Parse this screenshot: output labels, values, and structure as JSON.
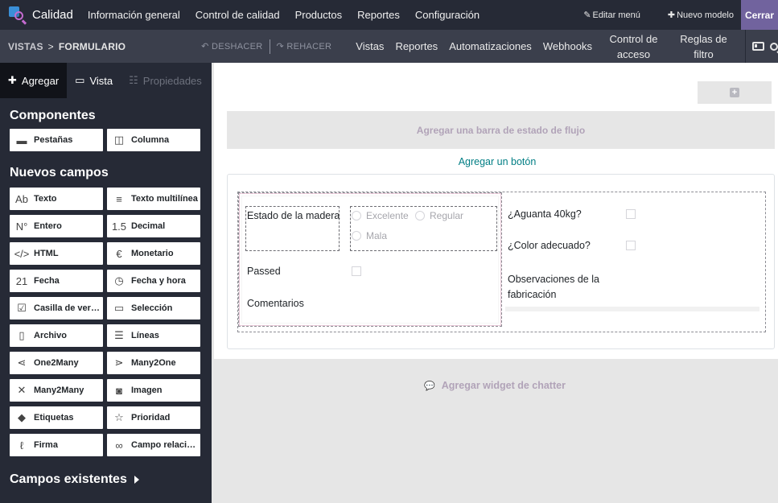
{
  "topbar": {
    "app_name": "Calidad",
    "menu": [
      "Información general",
      "Control de calidad",
      "Productos",
      "Reportes",
      "Configuración"
    ],
    "edit_menu": "Editar menú",
    "new_model": "Nuevo modelo",
    "close": "Cerrar"
  },
  "subbar": {
    "breadcrumb_root": "VISTAS",
    "breadcrumb_sep": ">",
    "breadcrumb_current": "FORMULARIO",
    "undo": "DESHACER",
    "redo": "REHACER",
    "nav": [
      "Vistas",
      "Reportes",
      "Automatizaciones",
      "Webhooks"
    ],
    "nav_multi": [
      "Control de acceso",
      "Reglas de filtro"
    ]
  },
  "sidebar": {
    "tabs": {
      "add": "Agregar",
      "view": "Vista",
      "properties": "Propiedades"
    },
    "components_title": "Componentes",
    "components": [
      {
        "label": "Pestañas",
        "icon": "tabs-icon"
      },
      {
        "label": "Columna",
        "icon": "columns-icon"
      }
    ],
    "new_fields_title": "Nuevos campos",
    "new_fields": [
      {
        "label": "Texto",
        "icon": "text-icon",
        "glyph": "Ab"
      },
      {
        "label": "Texto multilínea",
        "icon": "multiline-icon",
        "glyph": "≡"
      },
      {
        "label": "Entero",
        "icon": "integer-icon",
        "glyph": "N°"
      },
      {
        "label": "Decimal",
        "icon": "decimal-icon",
        "glyph": "1.5"
      },
      {
        "label": "HTML",
        "icon": "html-icon",
        "glyph": "</>"
      },
      {
        "label": "Monetario",
        "icon": "euro-icon",
        "glyph": "€"
      },
      {
        "label": "Fecha",
        "icon": "calendar-icon",
        "glyph": "21"
      },
      {
        "label": "Fecha y hora",
        "icon": "clock-icon",
        "glyph": "◷"
      },
      {
        "label": "Casilla de verificación",
        "icon": "checkbox-icon",
        "glyph": "☑"
      },
      {
        "label": "Selección",
        "icon": "selection-icon",
        "glyph": "▭"
      },
      {
        "label": "Archivo",
        "icon": "file-icon",
        "glyph": "▯"
      },
      {
        "label": "Líneas",
        "icon": "list-icon",
        "glyph": "☰"
      },
      {
        "label": "One2Many",
        "icon": "one2many-icon",
        "glyph": "⋖"
      },
      {
        "label": "Many2One",
        "icon": "many2one-icon",
        "glyph": "⋗"
      },
      {
        "label": "Many2Many",
        "icon": "many2many-icon",
        "glyph": "✕"
      },
      {
        "label": "Imagen",
        "icon": "camera-icon",
        "glyph": "◙"
      },
      {
        "label": "Etiquetas",
        "icon": "tag-icon",
        "glyph": "◆"
      },
      {
        "label": "Prioridad",
        "icon": "star-icon",
        "glyph": "☆"
      },
      {
        "label": "Firma",
        "icon": "signature-icon",
        "glyph": "ℓ"
      },
      {
        "label": "Campo relacionado",
        "icon": "link-icon",
        "glyph": "∞"
      }
    ],
    "existing_fields": "Campos existentes"
  },
  "canvas": {
    "statusbar": "Agregar una barra de estado de flujo",
    "add_button": "Agregar un botón",
    "left_group": {
      "estado_label": "Estado de la madera",
      "estado_options": [
        "Excelente",
        "Regular",
        "Mala"
      ],
      "passed_label": "Passed",
      "comments_label": "Comentarios"
    },
    "right_group": {
      "aguanta_label": "¿Aguanta 40kg?",
      "color_label": "¿Color adecuado?",
      "obs_label": "Observaciones de la fabricación"
    },
    "chatter": "Agregar widget de chatter"
  },
  "colors": {
    "topbar": "#262a36",
    "subbar": "#3b3f4c",
    "accent": "#71639e",
    "link": "#017e84"
  }
}
